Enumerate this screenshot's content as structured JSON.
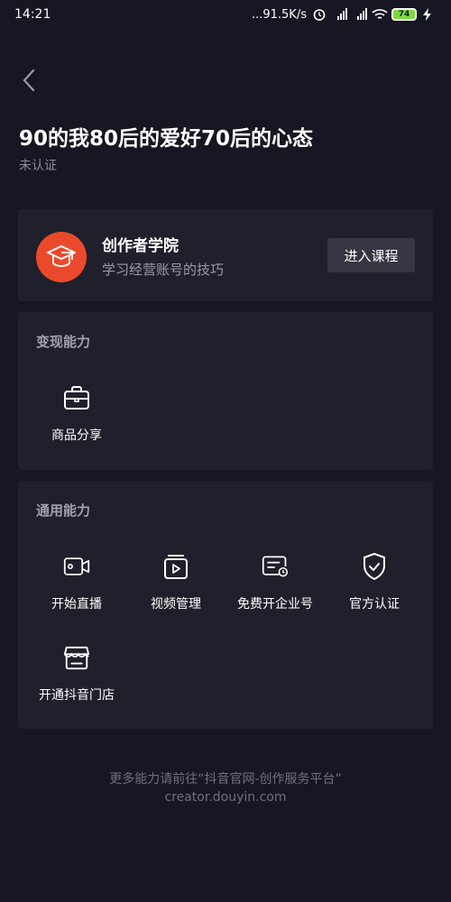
{
  "status_bar": {
    "time": "14:21",
    "network_speed": "...91.5K/s",
    "battery": "74",
    "icons": [
      "alarm-icon",
      "hd-signal-icon",
      "hd-signal-icon",
      "wifi-icon",
      "battery-icon",
      "charging-icon"
    ]
  },
  "header": {
    "back_icon": "chevron-left-icon",
    "title": "90的我80后的爱好70后的心态",
    "subtitle": "未认证"
  },
  "academy": {
    "icon": "graduation-cap-icon",
    "name": "创作者学院",
    "description": "学习经营账号的技巧",
    "button_label": "进入课程",
    "accent_color": "#ea4a2b"
  },
  "monetize": {
    "title": "变现能力",
    "items": [
      {
        "label": "商品分享",
        "icon": "shopping-bag-icon"
      }
    ]
  },
  "general": {
    "title": "通用能力",
    "items": [
      {
        "label": "开始直播",
        "icon": "video-camera-icon"
      },
      {
        "label": "视频管理",
        "icon": "video-library-icon"
      },
      {
        "label": "免费开企业号",
        "icon": "business-card-icon"
      },
      {
        "label": "官方认证",
        "icon": "shield-check-icon"
      },
      {
        "label": "开通抖音门店",
        "icon": "store-icon"
      }
    ]
  },
  "footer": {
    "line1": "更多能力请前往“抖音官网-创作服务平台”",
    "line2": "creator.douyin.com"
  }
}
